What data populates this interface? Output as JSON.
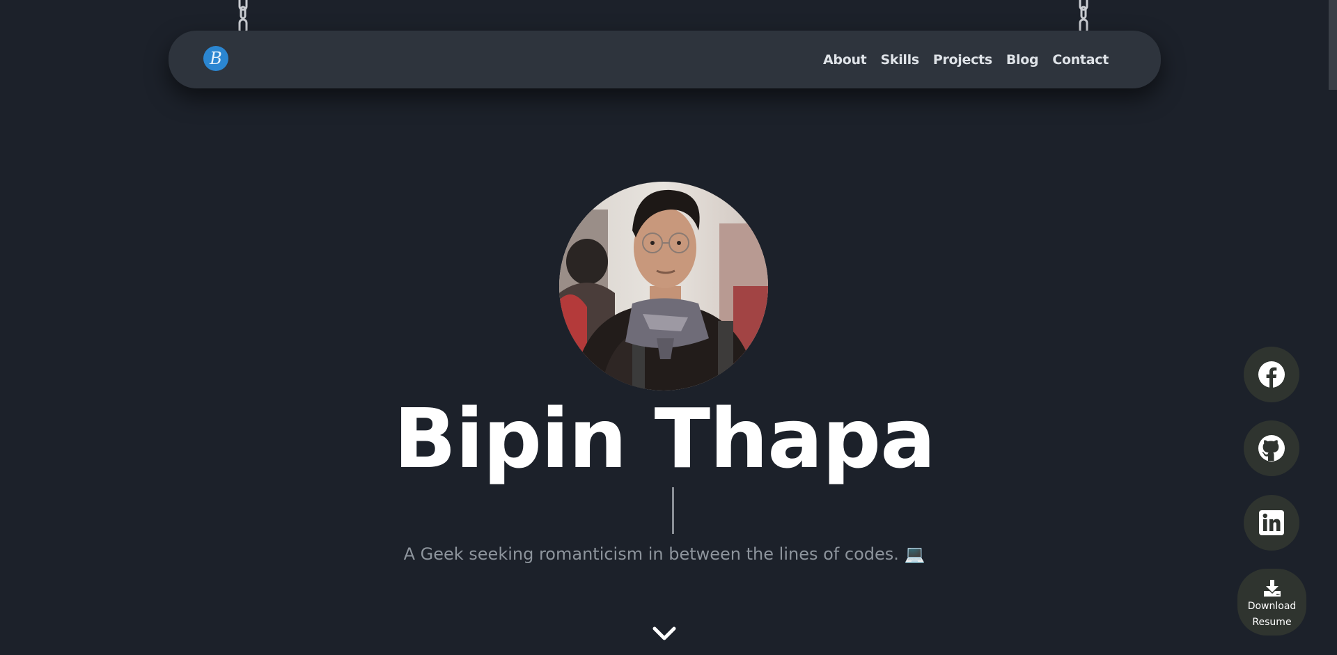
{
  "header": {
    "logo_letter": "B",
    "nav": [
      {
        "label": "About"
      },
      {
        "label": "Skills"
      },
      {
        "label": "Projects"
      },
      {
        "label": "Blog"
      },
      {
        "label": "Contact"
      }
    ]
  },
  "hero": {
    "name": "Bipin Thapa",
    "tagline": "A Geek seeking romanticism in between the lines of codes. 💻",
    "avatar_icon": "profile-photo",
    "scroll_icon": "chevron-down-icon"
  },
  "social": {
    "facebook_icon": "facebook-icon",
    "github_icon": "github-icon",
    "linkedin_icon": "linkedin-icon",
    "resume_line1": "Download",
    "resume_line2": "Resume",
    "resume_icon": "download-icon"
  },
  "colors": {
    "background": "#1c212a",
    "navbar": "#2e343d",
    "logo_accent": "#2b86d1",
    "social_button": "#2f342f",
    "tagline": "#8d949c"
  }
}
